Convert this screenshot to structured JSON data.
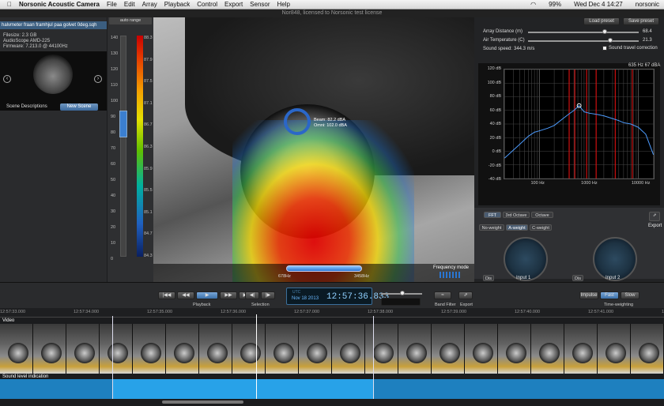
{
  "menubar": {
    "app": "Norsonic Acoustic Camera",
    "items": [
      "File",
      "Edit",
      "Array",
      "Playback",
      "Control",
      "Export",
      "Sensor",
      "Help"
    ],
    "battery": "99%",
    "clock": "Wed Dec 4  14:27",
    "user": "norsonic"
  },
  "window": {
    "title": "Nor848, licensed to Norsonic test license",
    "top_buttons": [
      "Load preset",
      "Save preset"
    ]
  },
  "left": {
    "file_title": "halvmeter fraan framhjul paa golvet 0deg.sqh",
    "filesize": "Filesize: 2.3 GB",
    "device": "AudioScope AMD-225",
    "firmware": "Firmware: 7.213.0 @ 44100Hz",
    "scene_label": "Scene Descriptions",
    "new_scene": "New Scene"
  },
  "scale": {
    "auto_range": "auto range",
    "left_ticks": [
      "140",
      "130",
      "120",
      "110",
      "100",
      "90",
      "80",
      "70",
      "60",
      "50",
      "40",
      "30",
      "20",
      "10",
      "0"
    ],
    "right_ticks": [
      "88.3",
      "87.9",
      "87.5",
      "87.1",
      "86.7",
      "86.3",
      "85.9",
      "85.5",
      "85.1",
      "84.7",
      "84.3"
    ],
    "selected": "95"
  },
  "view": {
    "beam": "Beam: 82.2 dBA",
    "omni": "Omni: 102.0 dBA",
    "freq_lo": "678Hz",
    "freq_hi": "3458Hz",
    "freq_mode": "Frequency mode"
  },
  "right": {
    "array_distance_label": "Array Distance (m)",
    "array_distance": "68.4",
    "air_temp_label": "Air Temperature (C)",
    "air_temp": "21.3",
    "sound_speed_label": "Sound speed:",
    "sound_speed": "344.3 m/s",
    "sound_travel": "Sound travel correction",
    "cursor_readout": "635 Hz 67 dBA",
    "yticks": [
      "120 dB",
      "100 dB",
      "80 dB",
      "60 dB",
      "40 dB",
      "20 dB",
      "0 dB",
      "-20 dB",
      "-40 dB"
    ],
    "xticks": [
      "100 Hz",
      "1000 Hz",
      "10000 Hz"
    ],
    "tabs1": [
      "FFT",
      "3rd Octave",
      "Octave"
    ],
    "tabs2": [
      "No-weight",
      "A-weight",
      "C-weight"
    ],
    "export": "Export",
    "input1": "Input 1",
    "input2": "Input 2",
    "toggle_l": "Dis",
    "toggle_r": "Dis"
  },
  "chart_data": {
    "type": "line",
    "title": "",
    "xlabel": "",
    "ylabel": "",
    "xscale": "log",
    "xlim": [
      20,
      20000
    ],
    "ylim": [
      -40,
      120
    ],
    "x": [
      20,
      40,
      60,
      80,
      100,
      150,
      200,
      300,
      400,
      500,
      635,
      800,
      1000,
      1500,
      2000,
      3000,
      4000,
      5000,
      7000,
      10000,
      14000,
      20000
    ],
    "series": [
      {
        "values": [
          -10,
          10,
          22,
          28,
          30,
          34,
          38,
          48,
          55,
          60,
          67,
          58,
          56,
          54,
          52,
          48,
          45,
          42,
          40,
          35,
          25,
          -5
        ]
      }
    ],
    "markers_hz": [
      400,
      520,
      900,
      1400,
      3400,
      7500
    ]
  },
  "transport": {
    "buttons": [
      "|◀◀",
      "◀◀",
      "▶",
      "▶▶",
      "▶▶|"
    ],
    "playback": "Playback",
    "selection": "Selection",
    "sel_buttons": [
      "◀|",
      "|▶"
    ],
    "time_small": "UTC",
    "date": "Nov 18 2013",
    "clock": "12:57:36.833",
    "band_filter": "Band Filter",
    "export": "Export",
    "time_weighting": "Time-weighting",
    "tw": [
      "Impulse",
      "Fast",
      "Slow"
    ]
  },
  "timeline": {
    "ticks": [
      "12:57:33.000",
      "12:57:34.000",
      "12:57:35.000",
      "12:57:36.000",
      "12:57:37.000",
      "12:57:38.000",
      "12:57:39.000",
      "12:57:40.000",
      "12:57:41.000",
      "12:57:42.000"
    ],
    "video": "Video",
    "level": "Sound level indication"
  }
}
